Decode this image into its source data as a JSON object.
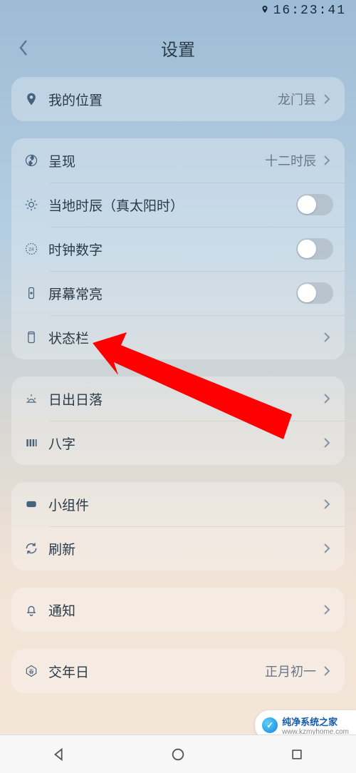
{
  "status_bar": {
    "time": "16:23:41"
  },
  "header": {
    "title": "设置"
  },
  "group_location": [
    {
      "icon": "location-pin-icon",
      "label": "我的位置",
      "value": "龙门县",
      "type": "link"
    }
  ],
  "group_display": [
    {
      "icon": "yinyang-icon",
      "label": "呈现",
      "value": "十二时辰",
      "type": "link"
    },
    {
      "icon": "sun-icon",
      "label": "当地时辰（真太阳时）",
      "type": "toggle",
      "on": false
    },
    {
      "icon": "clock-24-icon",
      "label": "时钟数字",
      "type": "toggle",
      "on": false
    },
    {
      "icon": "phone-bright-icon",
      "label": "屏幕常亮",
      "type": "toggle",
      "on": false
    },
    {
      "icon": "statusbar-icon",
      "label": "状态栏",
      "type": "link"
    }
  ],
  "group_time": [
    {
      "icon": "sunrise-icon",
      "label": "日出日落",
      "type": "link"
    },
    {
      "icon": "bars-icon",
      "label": "八字",
      "type": "link"
    }
  ],
  "group_widget": [
    {
      "icon": "widget-icon",
      "label": "小组件",
      "type": "link"
    },
    {
      "icon": "refresh-icon",
      "label": "刷新",
      "type": "link"
    }
  ],
  "group_notify": [
    {
      "icon": "bell-icon",
      "label": "通知",
      "type": "link"
    }
  ],
  "group_year": [
    {
      "icon": "spring-icon",
      "label": "交年日",
      "value": "正月初一",
      "type": "link"
    }
  ],
  "watermark": {
    "line1": "纯净系统之家",
    "line2": "www.kzmyhome.com"
  },
  "annotation": {
    "target": "状态栏"
  }
}
